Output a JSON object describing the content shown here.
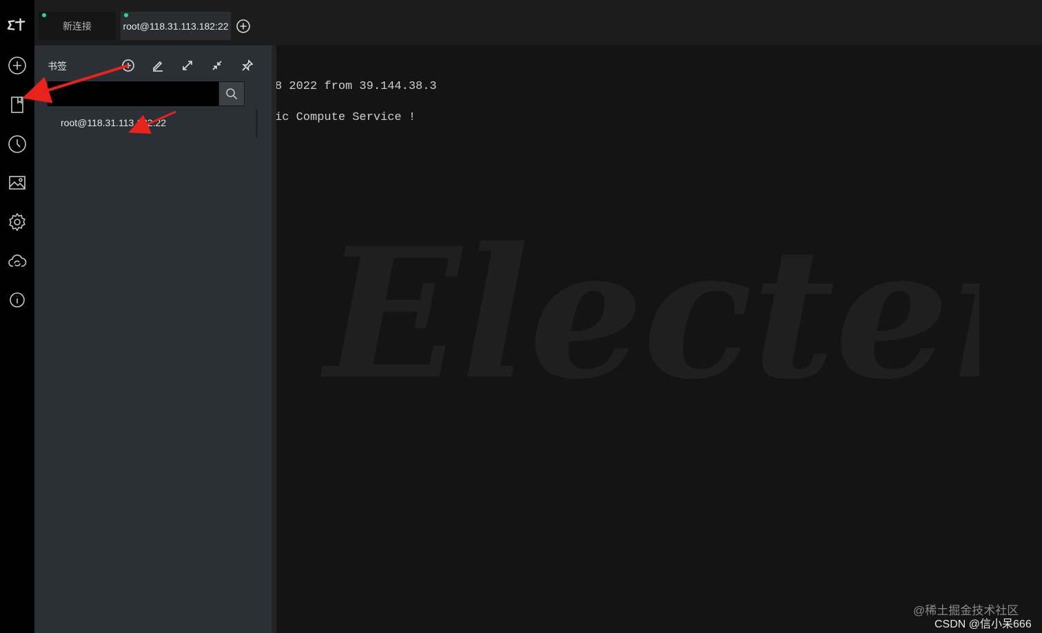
{
  "rail": {
    "logo": "ET",
    "icons": [
      "plus-circle-icon",
      "bookmark-icon",
      "history-icon",
      "image-icon",
      "settings-icon",
      "cloud-sync-icon",
      "info-icon"
    ]
  },
  "tabs": [
    {
      "label": "新连接",
      "status_color": "#2fd58a"
    },
    {
      "label": "root@118.31.113.182:22",
      "status_color": "#2fd58a"
    }
  ],
  "bookmark_panel": {
    "title": "书签",
    "search": {
      "value": "",
      "placeholder": ""
    },
    "items": [
      {
        "label": "root@118.31.113.182:22"
      }
    ]
  },
  "terminal": {
    "lines": [
      "8 2022 from 39.144.38.3",
      "ic Compute Service !"
    ],
    "watermark": "Electerm"
  },
  "overlay": {
    "source_watermark": "@稀土掘金技术社区",
    "author_watermark": "CSDN @信小呆666"
  },
  "colors": {
    "status_dot": "#2fd58a",
    "annotation_arrow": "#e8231c"
  }
}
